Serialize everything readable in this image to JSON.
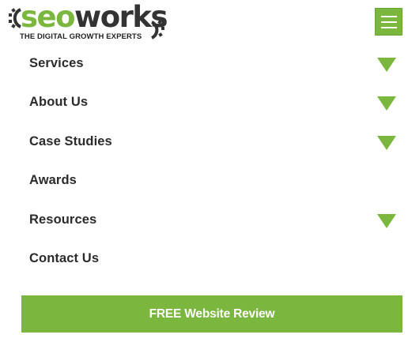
{
  "brand": {
    "logo_text_seo": "seo",
    "logo_text_works": "works",
    "tagline": "THE DIGITAL GROWTH EXPERTS",
    "accent_color": "#7bb73f",
    "dark_color": "#333333"
  },
  "header": {
    "menu_toggle_icon": "hamburger-icon"
  },
  "nav": {
    "items": [
      {
        "label": "Services",
        "has_submenu": true,
        "icon": "chevron-down-icon"
      },
      {
        "label": "About Us",
        "has_submenu": true,
        "icon": "chevron-down-icon"
      },
      {
        "label": "Case Studies",
        "has_submenu": true,
        "icon": "chevron-down-icon"
      },
      {
        "label": "Awards",
        "has_submenu": false
      },
      {
        "label": "Resources",
        "has_submenu": true,
        "icon": "chevron-down-icon"
      },
      {
        "label": "Contact Us",
        "has_submenu": false
      }
    ]
  },
  "cta": {
    "label": "FREE Website Review"
  }
}
